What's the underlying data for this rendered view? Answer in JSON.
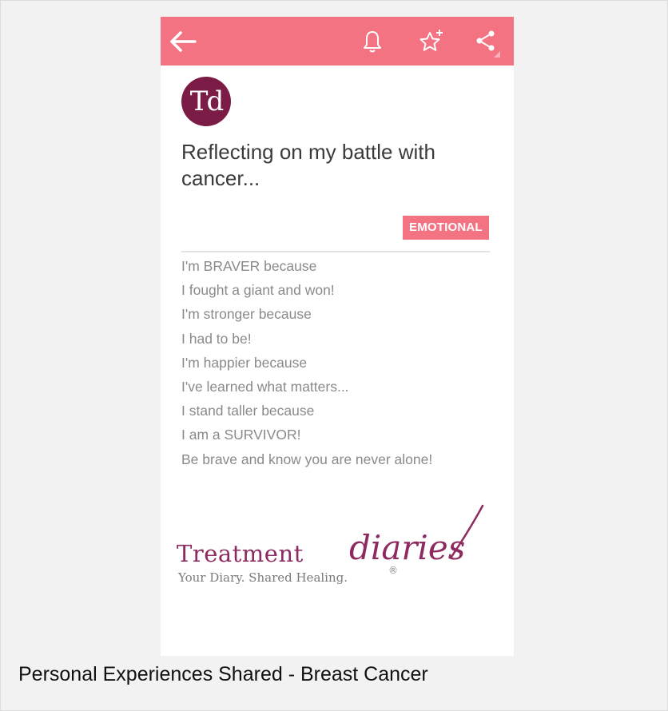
{
  "colors": {
    "accent": "#f47383",
    "brand": "#8d2a5f",
    "body_text": "#8a8a8a",
    "frame_background": "#f2f2f2"
  },
  "toolbar": {
    "icons": [
      "back-arrow-icon",
      "bell-icon",
      "star-add-icon",
      "share-icon"
    ]
  },
  "post": {
    "avatar_initials": "Td",
    "title": "Reflecting on my battle with cancer...",
    "tag": "EMOTIONAL",
    "lines": [
      "I'm BRAVER because",
      "I fought a giant and won!",
      "I'm stronger because",
      "I had to be!",
      "I'm happier because",
      "I've learned what matters...",
      "I stand taller because",
      "I am a SURVIVOR!",
      "Be brave and know you are never alone!"
    ]
  },
  "logo": {
    "word": "Treatment",
    "script": "diaries",
    "tagline": "Your Diary. Shared Healing.",
    "mark": "®"
  },
  "caption": "Personal Experiences Shared - Breast Cancer"
}
